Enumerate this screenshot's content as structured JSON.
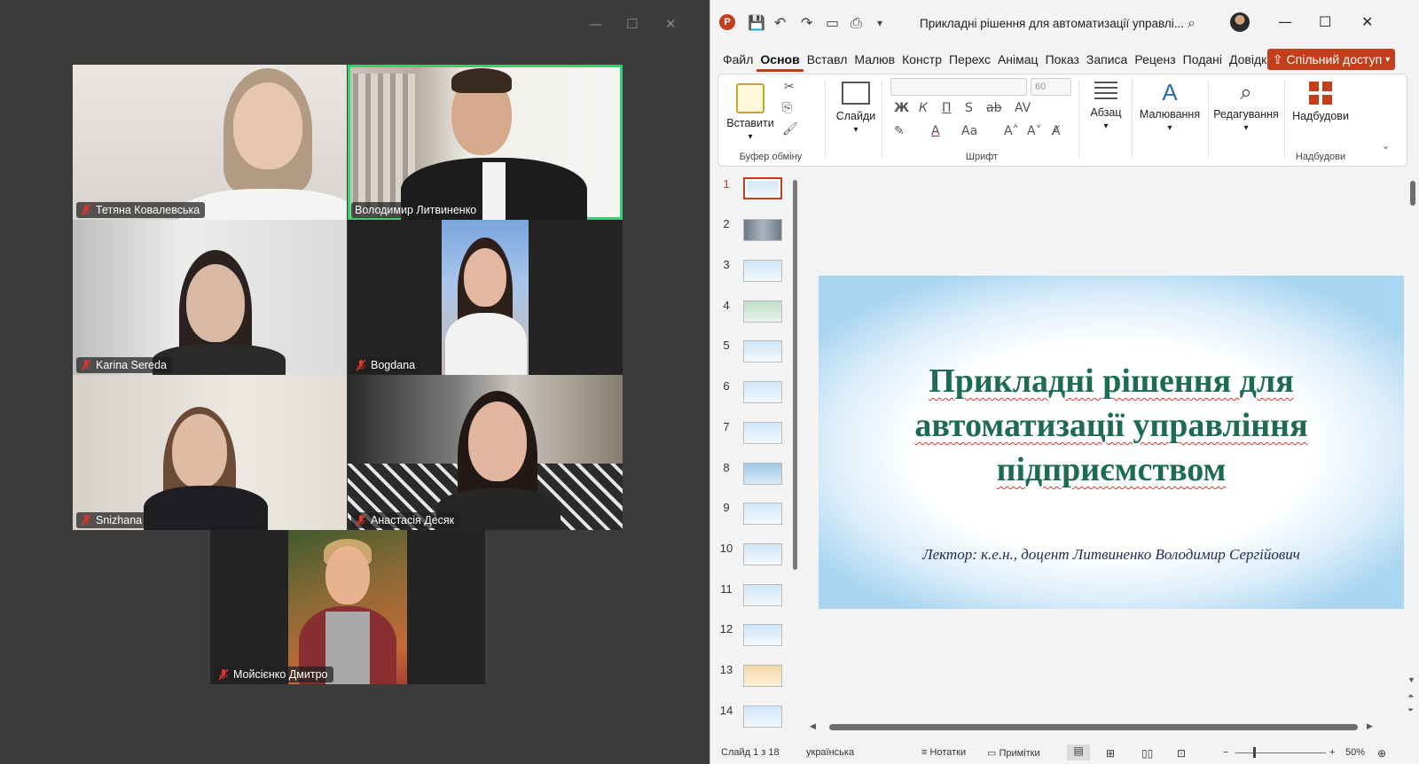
{
  "zoom": {
    "participants": [
      {
        "name": "Тетяна Ковалевська"
      },
      {
        "name": "Володимир Литвиненко"
      },
      {
        "name": "Karina Sereda"
      },
      {
        "name": "Bogdana"
      },
      {
        "name": "Snizhana"
      },
      {
        "name": "Анастасія Десяк"
      },
      {
        "name": "Мойсієнко Дмитро"
      }
    ],
    "active_speaker_color": "#2fd56e",
    "mute_color": "#e0352b"
  },
  "ppt": {
    "doc_title": "Прикладні рішення для автоматизації управлі...",
    "tabs": [
      "Файл",
      "Основ",
      "Вставл",
      "Малюв",
      "Констр",
      "Перехс",
      "Анімац",
      "Показ",
      "Записа",
      "Реценз",
      "Подані",
      "Довідк"
    ],
    "active_tab": "Основ",
    "share_label": "Спільний доступ",
    "ribbon": {
      "paste": "Вставити",
      "slides": "Слайди",
      "clipboard_group": "Буфер обміну",
      "font_size": "60",
      "bold": "Ж",
      "italic": "К",
      "underline": "П",
      "strike": "S",
      "font_group": "Шрифт",
      "paragraph": "Абзац",
      "drawing": "Малювання",
      "editing": "Редагування",
      "addins": "Надбудови",
      "addins_group": "Надбудови"
    },
    "thumbnails": [
      "1",
      "2",
      "3",
      "4",
      "5",
      "6",
      "7",
      "8",
      "9",
      "10",
      "11",
      "12",
      "13",
      "14"
    ],
    "slide": {
      "title": "Прикладні рішення для автоматизації управління підприємством",
      "lector": "Лектор: к.е.н., доцент Литвиненко Володимир Сергійович"
    },
    "status": {
      "slide_counter": "Слайд 1 з 18",
      "language": "українська",
      "notes": "Нотатки",
      "comments": "Примітки",
      "zoom": "50%"
    },
    "accent": "#c43e1c"
  }
}
